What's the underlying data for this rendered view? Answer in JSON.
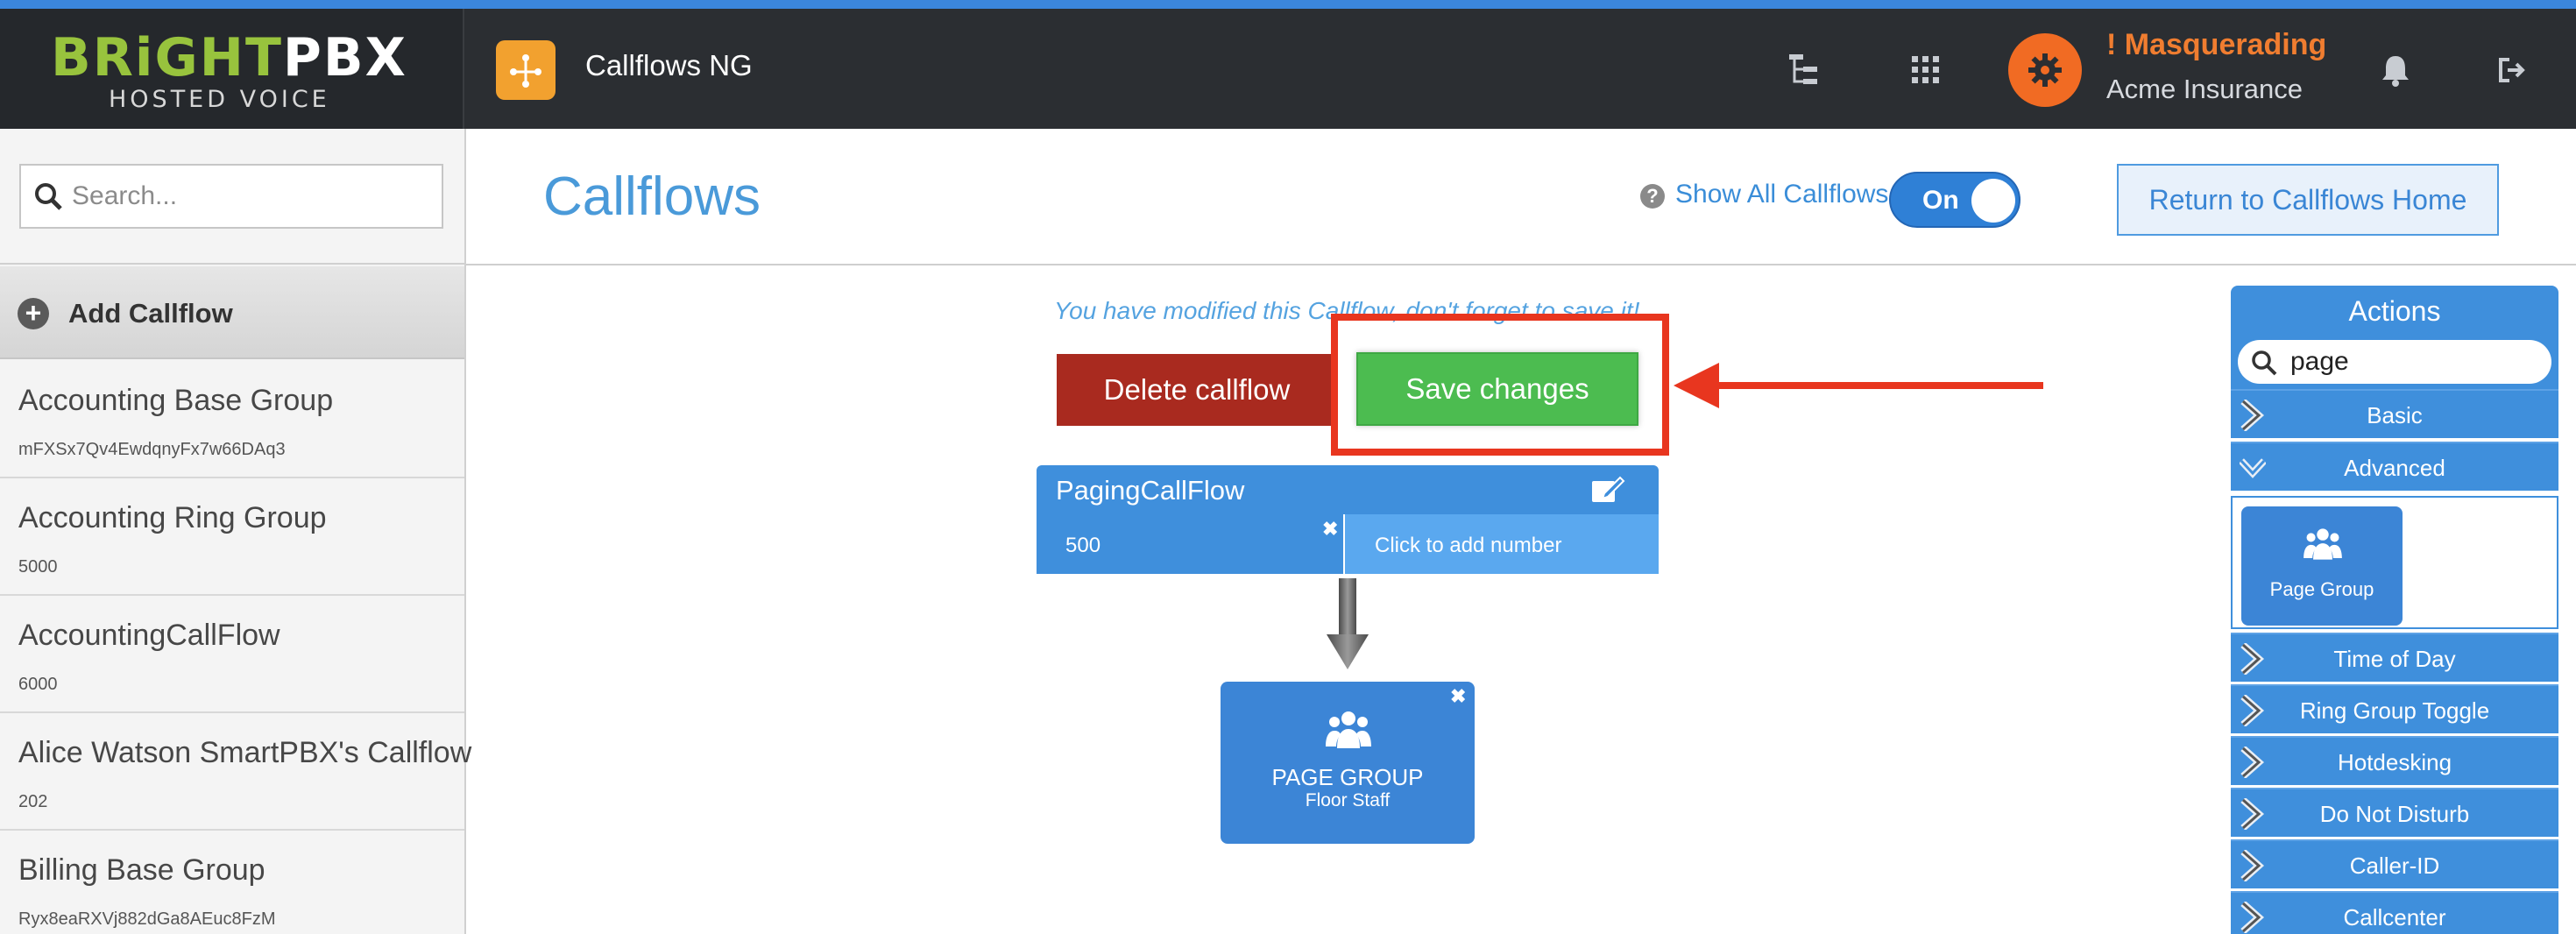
{
  "brand": {
    "part1": "BRiGHT",
    "part2": "PBX",
    "tagline": "HOSTED VOICE"
  },
  "app": {
    "title": "Callflows NG"
  },
  "topbar": {
    "masquerading": "! Masquerading",
    "account": "Acme Insurance"
  },
  "sidebar": {
    "search_placeholder": "Search...",
    "add_label": "Add Callflow",
    "items": [
      {
        "name": "Accounting Base Group",
        "sub": "mFXSx7Qv4EwdqnyFx7w66DAq3"
      },
      {
        "name": "Accounting Ring Group",
        "sub": "5000"
      },
      {
        "name": "AccountingCallFlow",
        "sub": "6000"
      },
      {
        "name": "Alice Watson SmartPBX's Callflow",
        "sub": "202"
      },
      {
        "name": "Billing Base Group",
        "sub": "Ryx8eaRXVj882dGa8AEuc8FzM"
      }
    ]
  },
  "header": {
    "title": "Callflows",
    "show_all_label": "Show All Callflows",
    "toggle_label": "On",
    "return_label": "Return to Callflows Home"
  },
  "editor": {
    "notice": "You have modified this Callflow, don't forget to save it!",
    "delete_label": "Delete callflow",
    "save_label": "Save changes",
    "callflow_name": "PagingCallFlow",
    "number": "500",
    "add_number": "Click to add number",
    "node_title": "PAGE GROUP",
    "node_subtitle": "Floor Staff"
  },
  "actions": {
    "title": "Actions",
    "search_value": "page",
    "categories": [
      "Basic",
      "Advanced",
      "Time of Day",
      "Ring Group Toggle",
      "Hotdesking",
      "Do Not Disturb",
      "Caller-ID",
      "Callcenter"
    ],
    "advanced_tile": "Page Group"
  },
  "colors": {
    "accent_blue": "#3f8fdc",
    "save_green": "#4cbc50",
    "delete_red": "#a92a1f",
    "highlight_red": "#e8361f",
    "masquerade_orange": "#f07d30"
  },
  "icons": [
    "app-flow-icon",
    "hierarchy-icon",
    "apps-grid-icon",
    "gear-icon",
    "bell-icon",
    "logout-icon",
    "search-icon",
    "add-icon",
    "help-icon",
    "edit-icon",
    "people-icon",
    "chevron-right-icon",
    "chevron-down-icon",
    "close-icon",
    "down-arrow-icon"
  ]
}
